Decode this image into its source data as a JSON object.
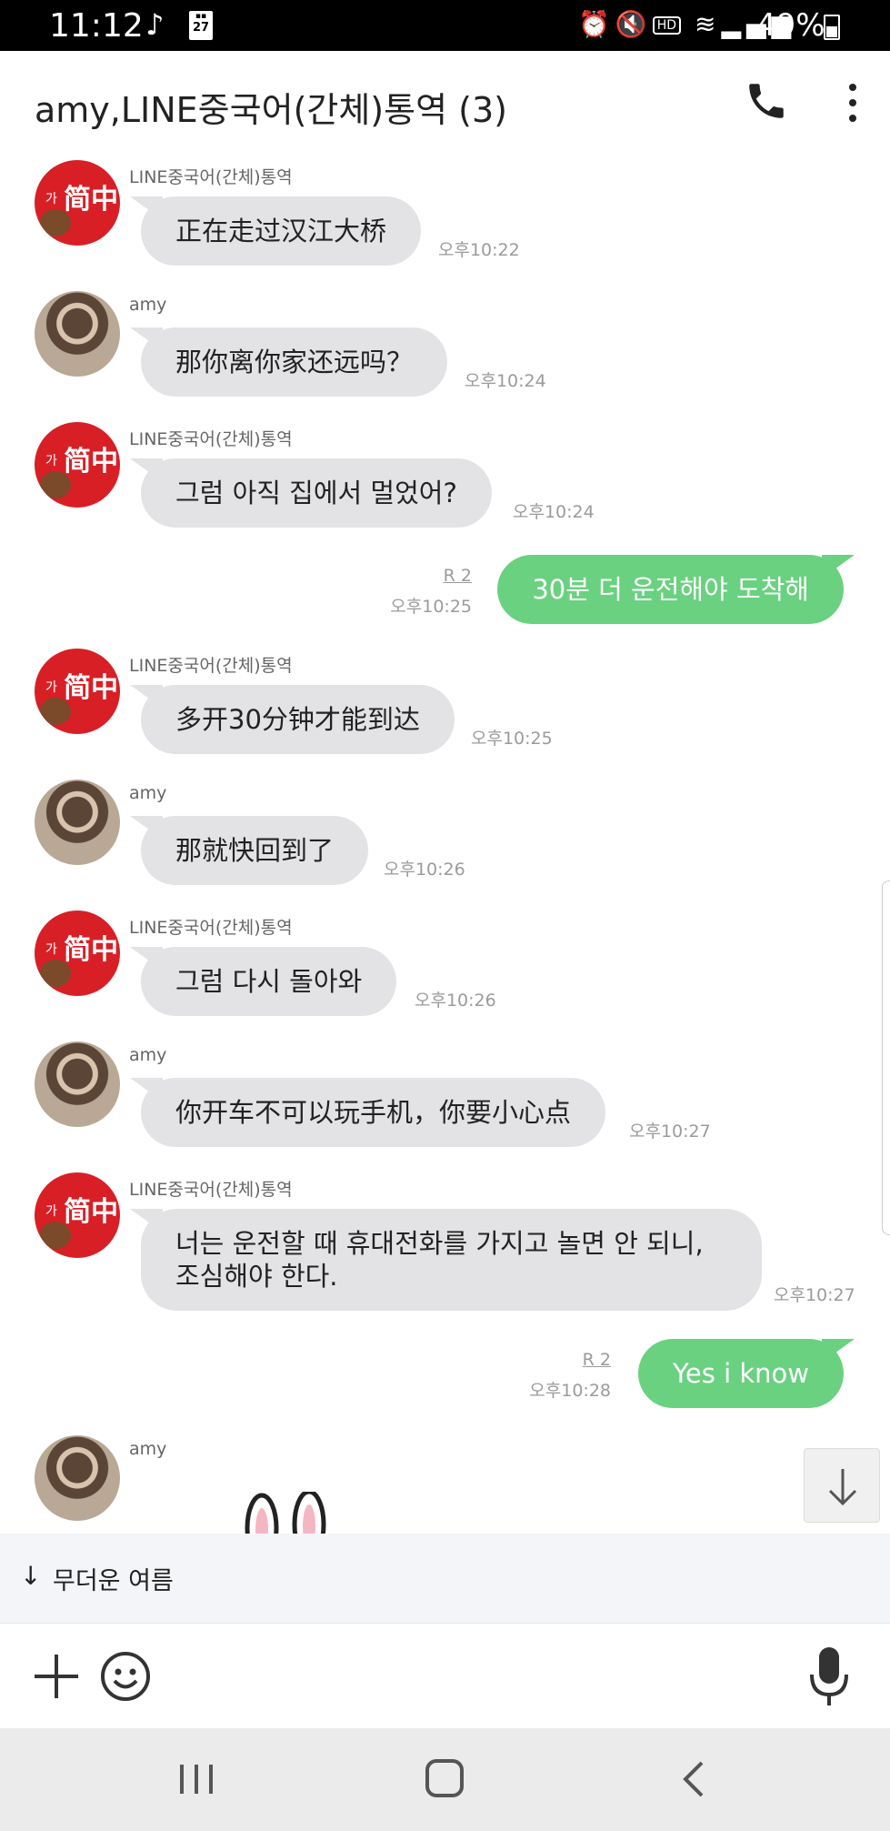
{
  "status_bar": {
    "time": "11:12",
    "calendar_day": "27",
    "hd_label": "HD",
    "battery": "49%"
  },
  "header": {
    "title": "amy,LINE중국어(간체)통역 (3)"
  },
  "messages": [
    {
      "sender": "LINE중국어(간체)통역",
      "text": "正在走过汉江大桥",
      "time": "오후10:22"
    },
    {
      "sender": "amy",
      "text": "那你离你家还远吗？",
      "time": "오후10:24"
    },
    {
      "sender": "LINE중국어(간체)통역",
      "text": "그럼 아직 집에서 멀었어?",
      "time": "오후10:24"
    },
    {
      "sender": "me",
      "text": "30분 더 운전해야  도착해",
      "time": "오후10:25",
      "read": "R 2"
    },
    {
      "sender": "LINE중국어(간체)통역",
      "text": "多开30分钟才能到达",
      "time": "오후10:25"
    },
    {
      "sender": "amy",
      "text": "那就快回到了",
      "time": "오후10:26"
    },
    {
      "sender": "LINE중국어(간체)통역",
      "text": "그럼 다시 돌아와",
      "time": "오후10:26"
    },
    {
      "sender": "amy",
      "text": "你开车不可以玩手机，你要小心点",
      "time": "오후10:27"
    },
    {
      "sender": "LINE중국어(간체)통역",
      "text": "너는 운전할 때 휴대전화를 가지고 놀면 안 되니, 조심해야 한다.",
      "time": "오후10:27"
    },
    {
      "sender": "me",
      "text": "Yes i know",
      "time": "오후10:28",
      "read": "R 2"
    },
    {
      "sender": "amy",
      "text": "",
      "time": ""
    }
  ],
  "bot_avatar": {
    "small": "가",
    "big": "简中"
  },
  "sticker_bar": {
    "arrow": "↓",
    "name": "무더운 여름"
  },
  "colors": {
    "outgoing_bubble": "#6ad180",
    "incoming_bubble": "#e3e3e6",
    "bot_avatar": "#d81f26"
  },
  "icons": [
    "phone-icon",
    "more-vert-icon",
    "plus-icon",
    "emoji-icon",
    "mic-icon",
    "arrow-down-icon",
    "recent-apps-icon",
    "home-icon",
    "back-icon"
  ]
}
